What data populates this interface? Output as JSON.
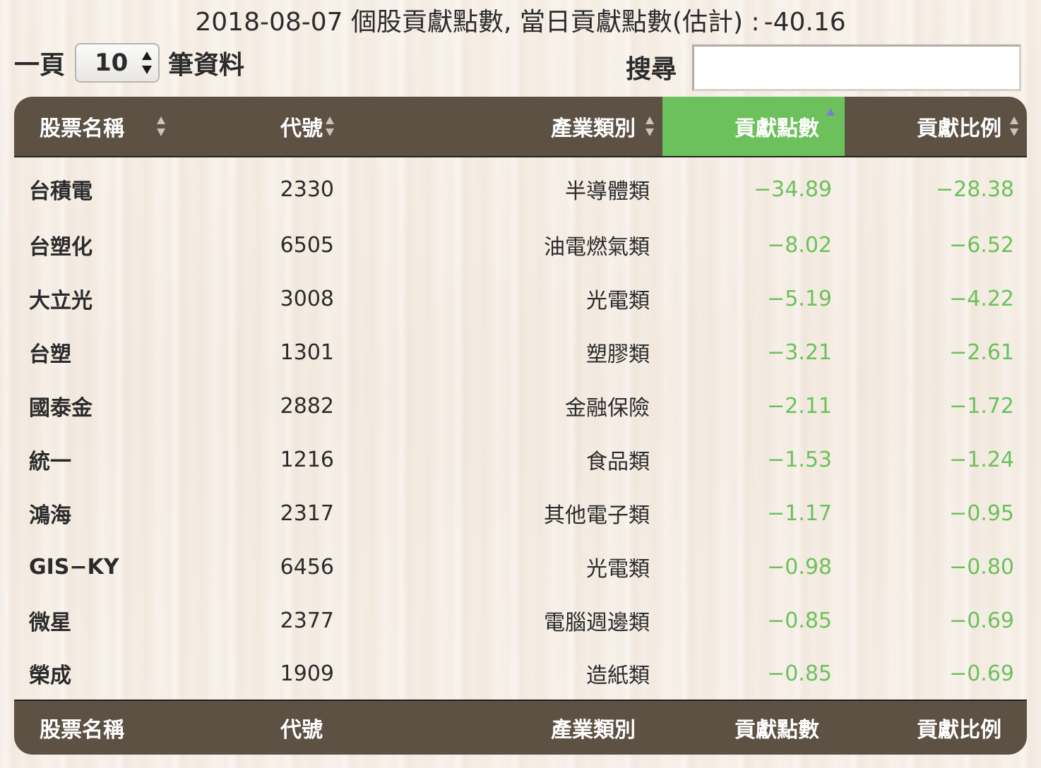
{
  "title": {
    "text": "2018-08-07 個股貢獻點數, 當日貢獻點數(估計) :",
    "score": "-40.16"
  },
  "length_control": {
    "prefix": "一頁",
    "selected": "10",
    "suffix": "筆資料"
  },
  "search": {
    "label": "搜尋",
    "value": ""
  },
  "table": {
    "columns": [
      "股票名稱",
      "代號",
      "產業類別",
      "貢獻點數",
      "貢獻比例"
    ],
    "sorted_column": "貢獻點數",
    "sort_direction": "ascending",
    "rows": [
      {
        "name": "台積電",
        "code": "2330",
        "industry": "半導體類",
        "points": "−34.89",
        "ratio": "−28.38"
      },
      {
        "name": "台塑化",
        "code": "6505",
        "industry": "油電燃氣類",
        "points": "−8.02",
        "ratio": "−6.52"
      },
      {
        "name": "大立光",
        "code": "3008",
        "industry": "光電類",
        "points": "−5.19",
        "ratio": "−4.22"
      },
      {
        "name": "台塑",
        "code": "1301",
        "industry": "塑膠類",
        "points": "−3.21",
        "ratio": "−2.61"
      },
      {
        "name": "國泰金",
        "code": "2882",
        "industry": "金融保險",
        "points": "−2.11",
        "ratio": "−1.72"
      },
      {
        "name": "統一",
        "code": "1216",
        "industry": "食品類",
        "points": "−1.53",
        "ratio": "−1.24"
      },
      {
        "name": "鴻海",
        "code": "2317",
        "industry": "其他電子類",
        "points": "−1.17",
        "ratio": "−0.95"
      },
      {
        "name": "GIS−KY",
        "code": "6456",
        "industry": "光電類",
        "points": "−0.98",
        "ratio": "−0.80"
      },
      {
        "name": "微星",
        "code": "2377",
        "industry": "電腦週邊類",
        "points": "−0.85",
        "ratio": "−0.69"
      },
      {
        "name": "榮成",
        "code": "1909",
        "industry": "造紙類",
        "points": "−0.85",
        "ratio": "−0.69"
      }
    ]
  },
  "colors": {
    "header_bg": "#5d5144",
    "sorted_header_bg": "#6cc15c",
    "negative_value": "#6cc15c",
    "sort_icon": "#c8c3bc",
    "sort_active": "#7a7fd6"
  }
}
